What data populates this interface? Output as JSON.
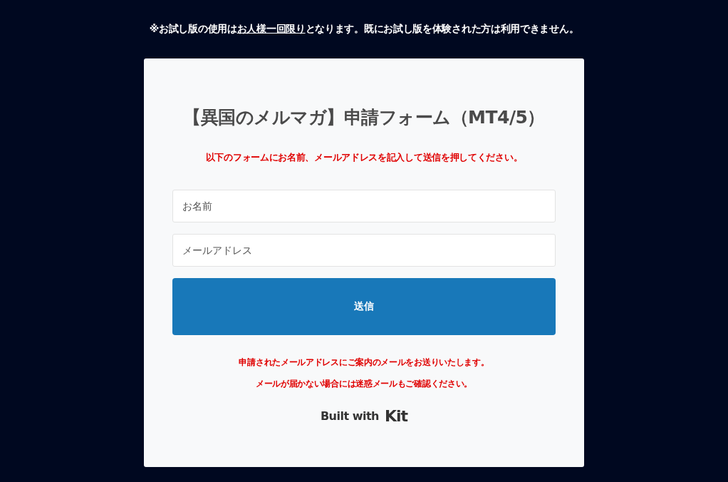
{
  "notice": {
    "before": "※お試し版の使用は",
    "link": "お人様一回限り",
    "after": "となります。既にお試し版を体験された方は利用できません。"
  },
  "form": {
    "title": "【異国のメルマガ】申請フォーム（MT4/5）",
    "instruction": "以下のフォームにお名前、メールアドレスを記入して送信を押してください。",
    "fields": [
      {
        "placeholder": "お名前"
      },
      {
        "placeholder": "メールアドレス"
      }
    ],
    "submit": "送信",
    "notes": [
      "申請されたメールアドレスにご案内のメールをお送りいたします。",
      "メールが届かない場合には迷惑メールもご確認ください。"
    ],
    "badge": {
      "prefix": "Built with",
      "brand": "Kit"
    }
  }
}
